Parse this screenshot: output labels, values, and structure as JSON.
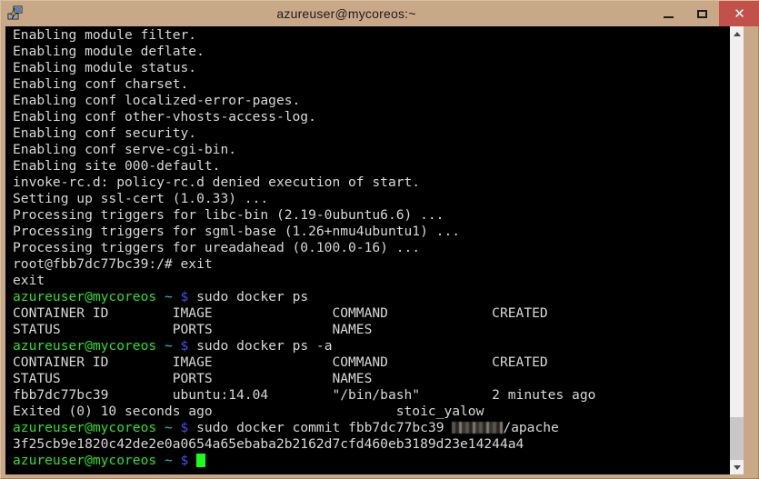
{
  "window": {
    "title": "azureuser@mycoreos:~",
    "icon": "putty-terminal-icon",
    "minimize_label": "–",
    "maximize_label": "□",
    "close_label": "✕",
    "close_button_color": "#c2504b",
    "titlebar_color": "#c9a887"
  },
  "terminal": {
    "background_color": "#000000",
    "foreground_color": "#d8d8d8",
    "prompt_user_host_color": "#2ee02e",
    "prompt_path_color": "#28c8c8",
    "prompt_sigil_color": "#4b4bf0",
    "cursor_color": "#1aff1a",
    "prompt": {
      "user_host": "azureuser@mycoreos",
      "path": "~",
      "sigil": "$"
    },
    "lines": [
      {
        "id": "l01",
        "text": "Enabling module filter."
      },
      {
        "id": "l02",
        "text": "Enabling module deflate."
      },
      {
        "id": "l03",
        "text": "Enabling module status."
      },
      {
        "id": "l04",
        "text": "Enabling conf charset."
      },
      {
        "id": "l05",
        "text": "Enabling conf localized-error-pages."
      },
      {
        "id": "l06",
        "text": "Enabling conf other-vhosts-access-log."
      },
      {
        "id": "l07",
        "text": "Enabling conf security."
      },
      {
        "id": "l08",
        "text": "Enabling conf serve-cgi-bin."
      },
      {
        "id": "l09",
        "text": "Enabling site 000-default."
      },
      {
        "id": "l10",
        "text": "invoke-rc.d: policy-rc.d denied execution of start."
      },
      {
        "id": "l11",
        "text": "Setting up ssl-cert (1.0.33) ..."
      },
      {
        "id": "l12",
        "text": "Processing triggers for libc-bin (2.19-0ubuntu6.6) ..."
      },
      {
        "id": "l13",
        "text": "Processing triggers for sgml-base (1.26+nmu4ubuntu1) ..."
      },
      {
        "id": "l14",
        "text": "Processing triggers for ureadahead (0.100.0-16) ..."
      },
      {
        "id": "l15",
        "text": "root@fbb7dc77bc39:/# exit"
      },
      {
        "id": "l16",
        "text": "exit"
      },
      {
        "id": "l18",
        "text": "CONTAINER ID        IMAGE               COMMAND             CREATED"
      },
      {
        "id": "l19",
        "text": "STATUS              PORTS               NAMES"
      },
      {
        "id": "l21",
        "text": "CONTAINER ID        IMAGE               COMMAND             CREATED"
      },
      {
        "id": "l22",
        "text": "STATUS              PORTS               NAMES"
      },
      {
        "id": "l23",
        "text": "fbb7dc77bc39        ubuntu:14.04        \"/bin/bash\"         2 minutes ago"
      },
      {
        "id": "l24",
        "text": "Exited (0) 10 seconds ago                       stoic_yalow"
      },
      {
        "id": "l26",
        "text": "3f25cb9e1820c42de2e0a0654a65ebaba2b2162d7cfd460eb3189d23e14244a4"
      }
    ],
    "commands": {
      "docker_ps": "sudo docker ps",
      "docker_ps_all": "sudo docker ps -a",
      "docker_commit_before": "sudo docker commit fbb7dc77bc39 ",
      "docker_commit_redacted": "",
      "docker_commit_after": "/apache"
    }
  },
  "scrollbar": {
    "name": "terminal-vertical-scrollbar",
    "up_arrow": "scroll-up-arrow-icon",
    "down_arrow": "scroll-down-arrow-icon",
    "thumb": "scrollbar-thumb"
  }
}
